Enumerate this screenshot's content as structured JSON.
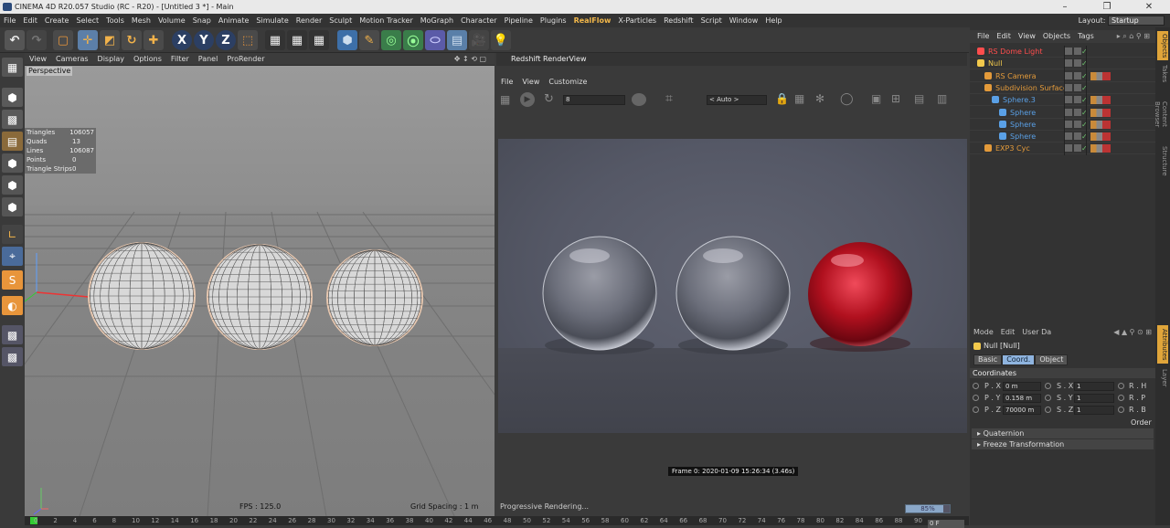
{
  "window": {
    "title": "CINEMA 4D R20.057 Studio (RC - R20) - [Untitled 3 *] - Main",
    "min": "–",
    "max": "❐",
    "close": "✕"
  },
  "menubar": {
    "items": [
      "File",
      "Edit",
      "Create",
      "Select",
      "Tools",
      "Mesh",
      "Volume",
      "Snap",
      "Animate",
      "Simulate",
      "Render",
      "Sculpt",
      "Motion Tracker",
      "MoGraph",
      "Character",
      "Pipeline",
      "Plugins",
      "RealFlow",
      "X-Particles",
      "Redshift",
      "Script",
      "Window",
      "Help"
    ],
    "layout_label": "Layout:",
    "layout_value": "Startup"
  },
  "viewport": {
    "menu": [
      "View",
      "Cameras",
      "Display",
      "Options",
      "Filter",
      "Panel",
      "ProRender"
    ],
    "camera_label": "Perspective",
    "stats": [
      {
        "k": "Triangles",
        "v": "106057"
      },
      {
        "k": "Quads",
        "v": "13"
      },
      {
        "k": "Lines",
        "v": "106087"
      },
      {
        "k": "Points",
        "v": "0"
      },
      {
        "k": "Triangle Strips",
        "v": "0"
      }
    ],
    "fps": "FPS : 125.0",
    "grid_spacing": "Grid Spacing : 1 m"
  },
  "renderview": {
    "title": "Redshift RenderView",
    "menu": [
      "File",
      "View",
      "Customize"
    ],
    "frame_field": "8",
    "auto_field": "< Auto >",
    "frame_info": "Frame  0:  2020-01-09  15:26:34  (3.46s)",
    "progress_text": "Progressive Rendering...",
    "progress_value": "85%",
    "progress_fraction": 0.85
  },
  "objects": {
    "menu": [
      "File",
      "Edit",
      "View",
      "Objects",
      "Tags"
    ],
    "rows": [
      {
        "name": "RS Dome Light",
        "color": "#ff4d4d",
        "depth": 0
      },
      {
        "name": "Null",
        "color": "#f2c94c",
        "depth": 0
      },
      {
        "name": "RS Camera",
        "color": "#e39a3a",
        "depth": 1
      },
      {
        "name": "Subdivision Surface",
        "color": "#e39a3a",
        "depth": 1
      },
      {
        "name": "Sphere.3",
        "color": "#5aa0e6",
        "depth": 2
      },
      {
        "name": "Sphere",
        "color": "#5aa0e6",
        "depth": 3
      },
      {
        "name": "Sphere",
        "color": "#5aa0e6",
        "depth": 3
      },
      {
        "name": "Sphere",
        "color": "#5aa0e6",
        "depth": 3
      },
      {
        "name": "EXP3 Cyc",
        "color": "#e39a3a",
        "depth": 1
      }
    ]
  },
  "attributes": {
    "menu": [
      "Mode",
      "Edit",
      "User Da"
    ],
    "object_title": "Null [Null]",
    "tabs": [
      "Basic",
      "Coord.",
      "Object"
    ],
    "section": "Coordinates",
    "rows": [
      {
        "p": "P . X",
        "pv": "0 m",
        "s": "S . X",
        "sv": "1",
        "r": "R . H"
      },
      {
        "p": "P . Y",
        "pv": "0.158 m",
        "s": "S . Y",
        "sv": "1",
        "r": "R . P"
      },
      {
        "p": "P . Z",
        "pv": "70000 m",
        "s": "S . Z",
        "sv": "1",
        "r": "R . B"
      }
    ],
    "order_label": "Order",
    "quaternion": "Quaternion",
    "freeze": "Freeze Transformation"
  },
  "side_tabs": [
    "Objects",
    "Takes",
    "Content Browser",
    "Structure",
    "Attributes",
    "Layer"
  ],
  "timeline": {
    "ticks": [
      "0",
      "2",
      "4",
      "6",
      "8",
      "10",
      "12",
      "14",
      "16",
      "18",
      "20",
      "22",
      "24",
      "26",
      "28",
      "30",
      "32",
      "34",
      "36",
      "38",
      "40",
      "42",
      "44",
      "46",
      "48",
      "50",
      "52",
      "54",
      "56",
      "58",
      "60",
      "62",
      "64",
      "66",
      "68",
      "70",
      "72",
      "74",
      "76",
      "78",
      "80",
      "82",
      "84",
      "86",
      "88",
      "90"
    ],
    "end_label": "0 F"
  }
}
